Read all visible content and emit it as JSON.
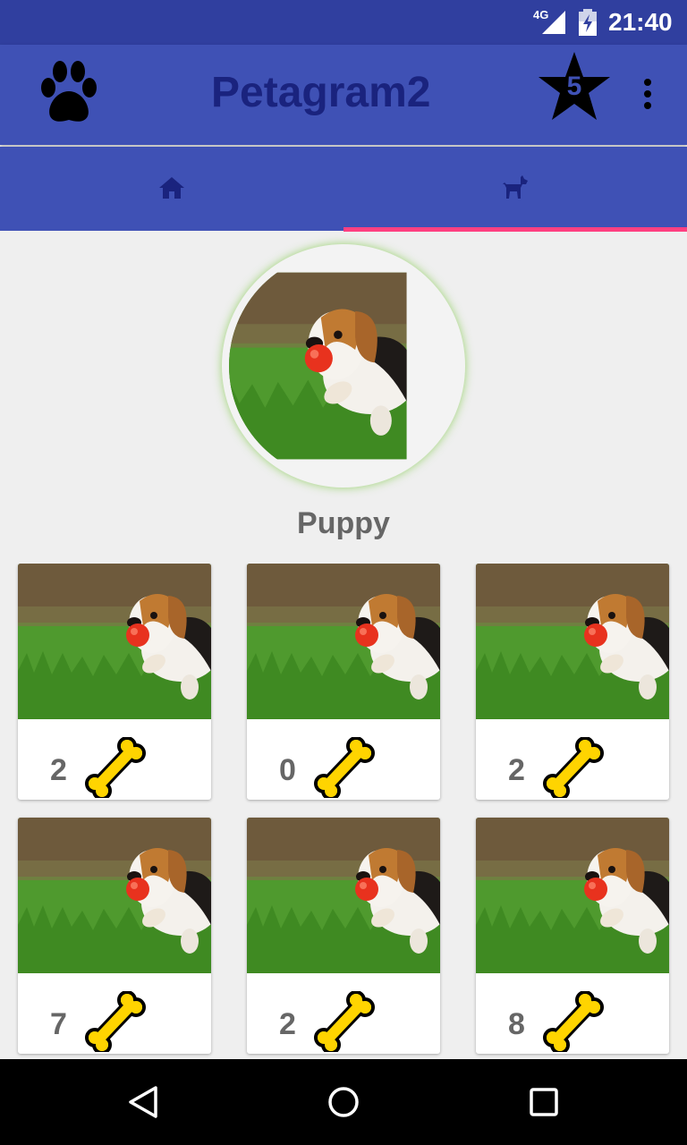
{
  "status_bar": {
    "network": "4G",
    "time": "21:40"
  },
  "app_bar": {
    "title": "Petagram2",
    "favorites_count": "5",
    "logo_icon": "paw-icon",
    "favorites_icon": "star-icon",
    "overflow_icon": "more-vert-icon"
  },
  "tabs": [
    {
      "icon": "home-icon",
      "selected": false
    },
    {
      "icon": "dog-icon",
      "selected": true
    }
  ],
  "profile": {
    "name": "Puppy"
  },
  "photos": [
    {
      "likes": "2"
    },
    {
      "likes": "0"
    },
    {
      "likes": "2"
    },
    {
      "likes": "7"
    },
    {
      "likes": "2"
    },
    {
      "likes": "8"
    }
  ],
  "colors": {
    "status_bar": "#303f9f",
    "primary": "#3f51b5",
    "title": "#1a237e",
    "accent": "#ff4081",
    "bone": "#ffd400"
  }
}
